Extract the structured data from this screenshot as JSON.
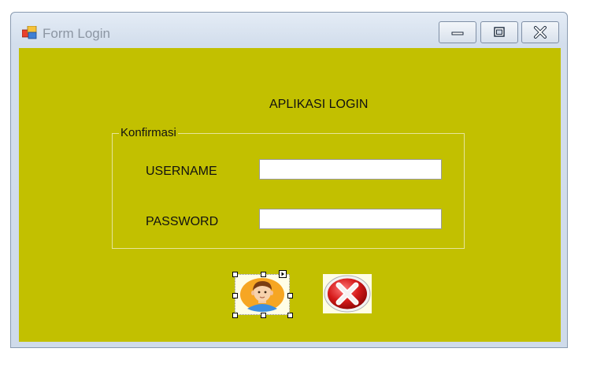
{
  "window": {
    "title": "Form Login",
    "icons": {
      "app": "form-app-icon",
      "minimize": "minimize-icon",
      "maximize": "maximize-icon",
      "close": "close-icon"
    }
  },
  "form": {
    "heading": "APLIKASI LOGIN",
    "group_label": "Konfirmasi",
    "username_label": "USERNAME",
    "username_value": "",
    "password_label": "PASSWORD",
    "password_value": "",
    "login_button_icon": "user-avatar-icon",
    "exit_button_icon": "red-x-icon"
  },
  "colors": {
    "form_background": "#c2c000",
    "input_background": "#ffffff"
  }
}
